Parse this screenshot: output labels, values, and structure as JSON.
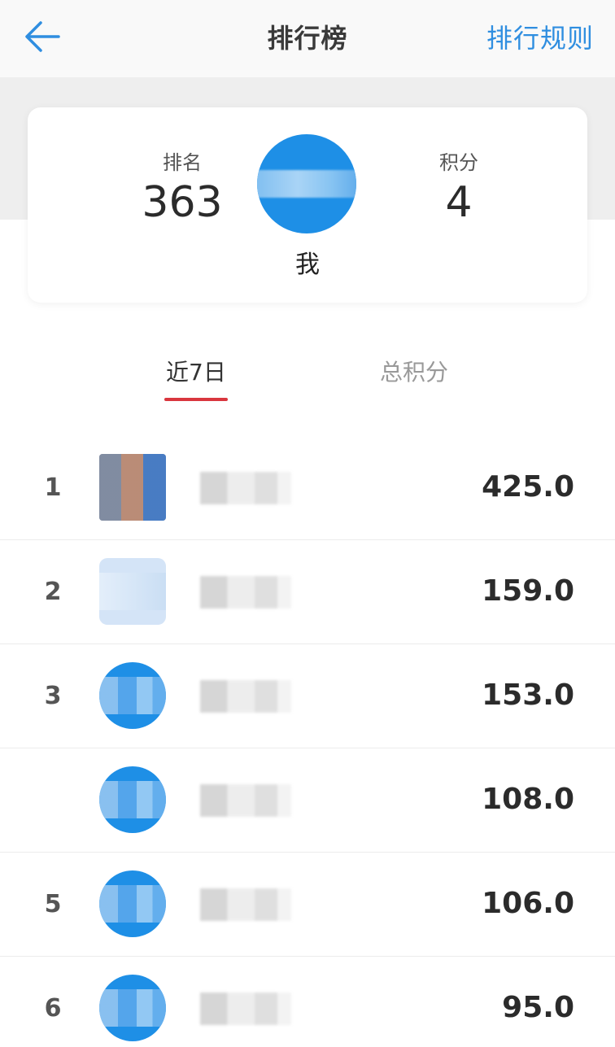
{
  "header": {
    "title": "排行榜",
    "rules_label": "排行规则",
    "back_icon": "arrow-left-icon",
    "accent_color": "#2f8ee0"
  },
  "my_card": {
    "rank_label": "排名",
    "rank_value": "363",
    "score_label": "积分",
    "score_value": "4",
    "name": "我",
    "avatar_color": "#1e8fe6"
  },
  "tabs": [
    {
      "label": "近7日",
      "active": true
    },
    {
      "label": "总积分",
      "active": false
    }
  ],
  "tab_underline_color": "#d9363e",
  "leaderboard": [
    {
      "rank": "1",
      "score": "425.0"
    },
    {
      "rank": "2",
      "score": "159.0"
    },
    {
      "rank": "3",
      "score": "153.0"
    },
    {
      "rank": "",
      "score": "108.0"
    },
    {
      "rank": "5",
      "score": "106.0"
    },
    {
      "rank": "6",
      "score": "95.0"
    }
  ]
}
